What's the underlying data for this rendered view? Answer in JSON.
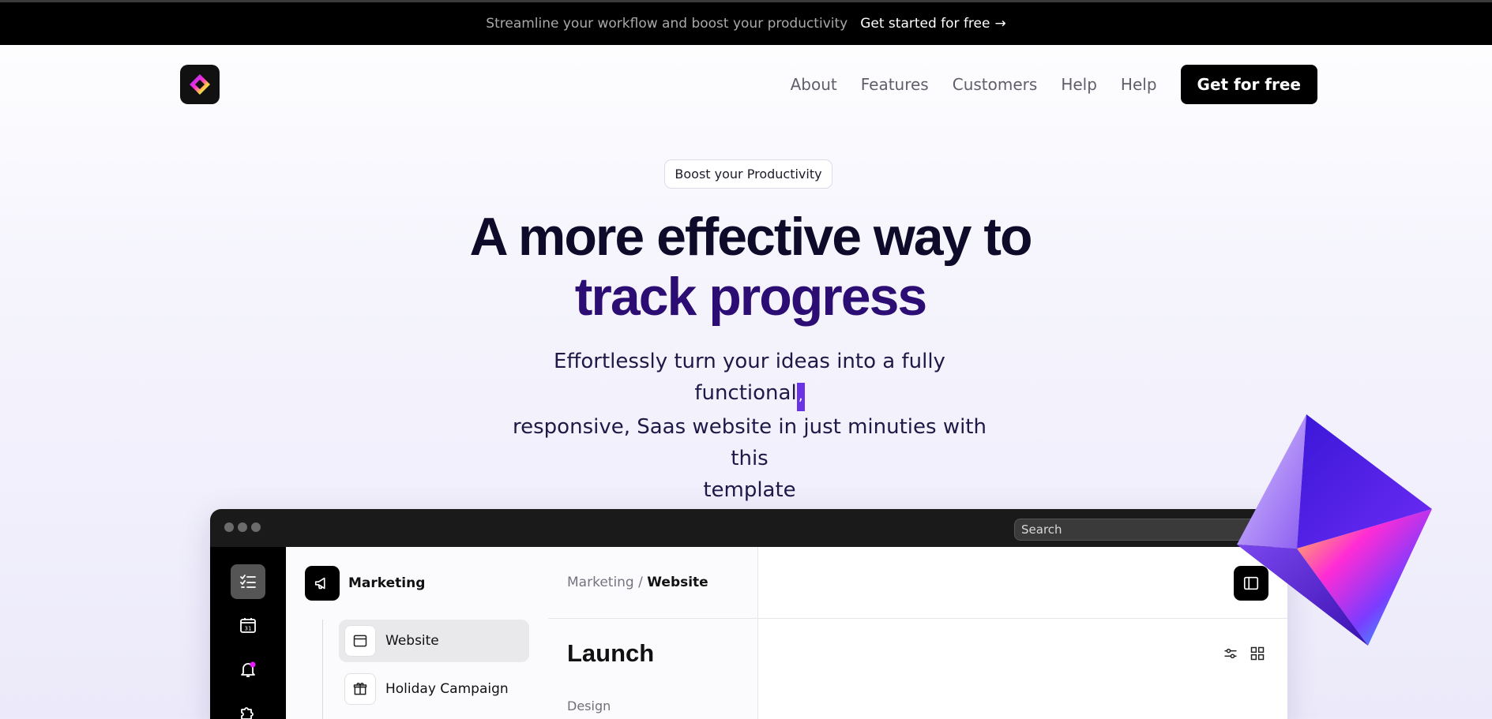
{
  "announcement": {
    "message": "Streamline your workflow and boost your productivity",
    "cta": "Get started for free",
    "cta_arrow": "→"
  },
  "nav": {
    "links": [
      "About",
      "Features",
      "Customers",
      "Help",
      "Help"
    ],
    "cta": "Get for free"
  },
  "hero": {
    "badge": "Boost your Productivity",
    "headline_line1": "A more effective way to",
    "headline_line2": "track progress",
    "subtitle_line1": "Effortlessly turn your ideas into a fully functional",
    "subtitle_caret": ",",
    "subtitle_line2": "responsive, Saas website in just minuties with this",
    "subtitle_line3": "template"
  },
  "app": {
    "search_placeholder": "Search",
    "sidebar": {
      "title": "Marketing",
      "items": [
        {
          "label": "Website",
          "selected": true
        },
        {
          "label": "Holiday Campaign",
          "selected": false
        }
      ]
    },
    "breadcrumb": {
      "parent": "Marketing /",
      "current": "Website"
    },
    "section_title": "Launch",
    "group_label": "Design",
    "iconbar": [
      "checklist-icon",
      "calendar-icon",
      "bell-icon",
      "puzzle-icon"
    ],
    "calendar_day": "31"
  },
  "colors": {
    "headline_dark": "#0e0b2a",
    "headline_accent": "#2b0d73",
    "caret": "#6a33e6",
    "notification_dot": "#e81cff"
  }
}
